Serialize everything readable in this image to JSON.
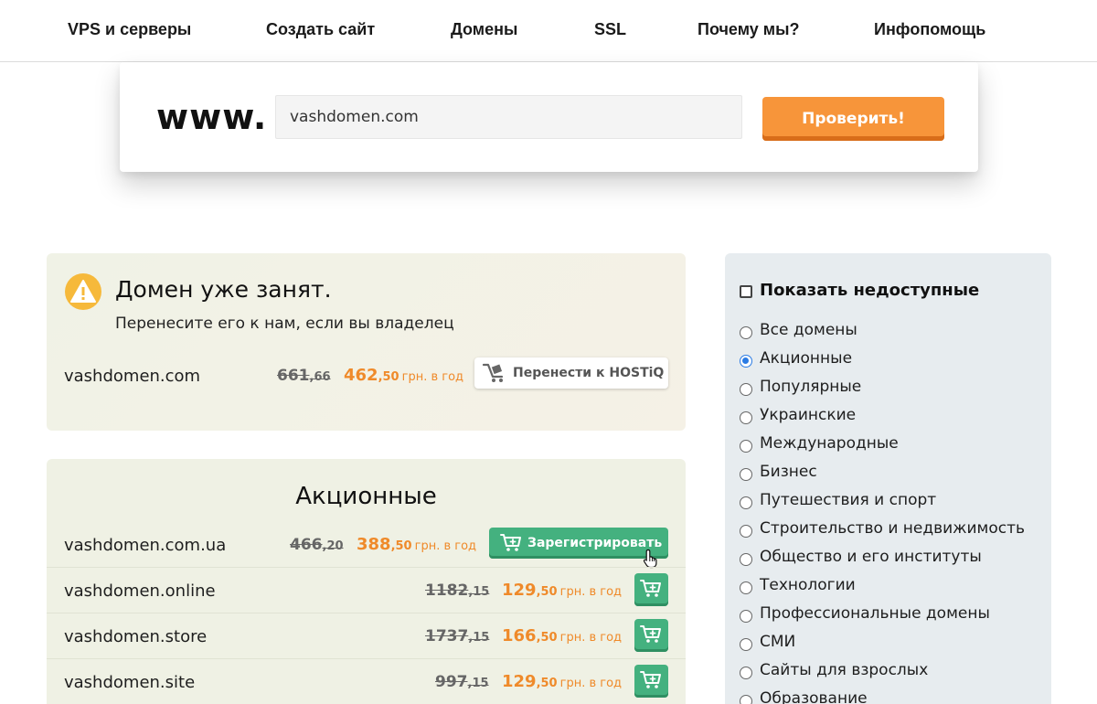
{
  "nav": {
    "items": [
      "VPS и серверы",
      "Создать сайт",
      "Домены",
      "SSL",
      "Почему мы?",
      "Инфопомощь"
    ]
  },
  "search": {
    "prefix": "www.",
    "value": "vashdomen.com",
    "button_label": "Проверить!"
  },
  "busy": {
    "title": "Домен уже занят.",
    "subtitle": "Перенесите его к нам, если вы владелец",
    "domain": "vashdomen.com",
    "old_price_int": "661",
    "old_price_dec": ",66",
    "new_price_int": "462",
    "new_price_dec": ",50",
    "per_year": "грн. в год",
    "transfer_label": "Перенести к HOSTiQ"
  },
  "promo": {
    "title": "Акционные",
    "register_label": "Зарегистрировать",
    "per_year": "грн. в год",
    "rows": [
      {
        "domain": "vashdomen.com.ua",
        "old_int": "466",
        "old_dec": ",20",
        "new_int": "388",
        "new_dec": ",50"
      },
      {
        "domain": "vashdomen.online",
        "old_int": "1182",
        "old_dec": ",15",
        "new_int": "129",
        "new_dec": ",50"
      },
      {
        "domain": "vashdomen.store",
        "old_int": "1737",
        "old_dec": ",15",
        "new_int": "166",
        "new_dec": ",50"
      },
      {
        "domain": "vashdomen.site",
        "old_int": "997",
        "old_dec": ",15",
        "new_int": "129",
        "new_dec": ",50"
      }
    ]
  },
  "filter": {
    "show_unavailable_label": "Показать недоступные",
    "show_unavailable_checked": false,
    "selected": "Акционные",
    "options": [
      "Все домены",
      "Акционные",
      "Популярные",
      "Украинские",
      "Международные",
      "Бизнес",
      "Путешествия и спорт",
      "Строительство и недвижимость",
      "Общество и его институты",
      "Технологии",
      "Профессиональные домены",
      "СМИ",
      "Сайты для взрослых",
      "Образование"
    ]
  },
  "colors": {
    "accent_orange": "#f7953a",
    "price_orange": "#ef8a2a",
    "register_green": "#44b17f",
    "filter_bg": "#e7ecef",
    "warning_yellow": "#f6b93b"
  }
}
